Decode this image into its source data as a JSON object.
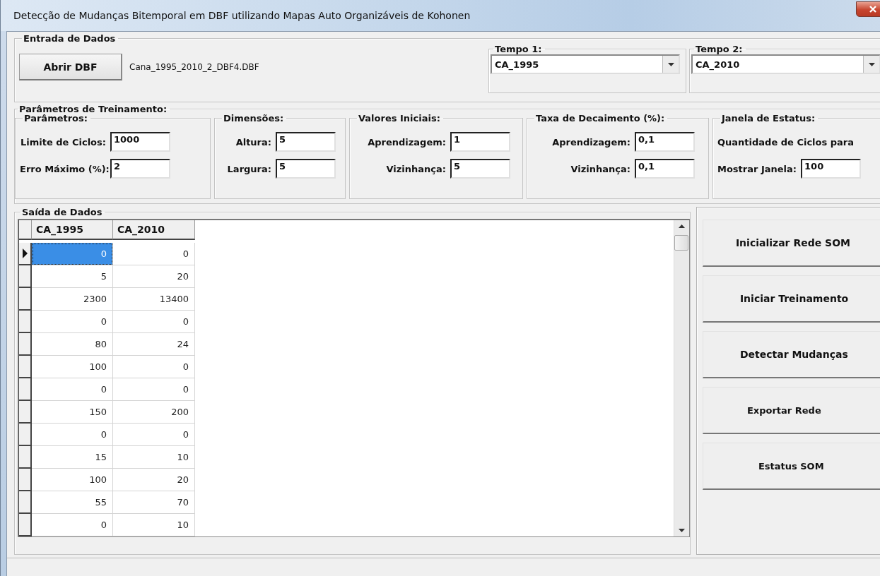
{
  "window": {
    "title": "Detecção de Mudanças Bitemporal em DBF utilizando Mapas Auto Organizáveis de Kohonen"
  },
  "input_section": {
    "title": "Entrada de Dados",
    "open_button": "Abrir DBF",
    "file_name": "Cana_1995_2010_2_DBF4.DBF",
    "time_selects": [
      {
        "label": "Tempo 1:",
        "value": "CA_1995"
      },
      {
        "label": "Tempo 2:",
        "value": "CA_2010"
      }
    ]
  },
  "training": {
    "title": "Parâmetros de Treinamento:",
    "groups": [
      {
        "title": "Parâmetros:",
        "items": [
          {
            "kind": "field",
            "label": "Limite de Ciclos:",
            "value": "1000"
          },
          {
            "kind": "field",
            "label": "Erro Máximo (%):",
            "value": "2"
          }
        ]
      },
      {
        "title": "Dimensões:",
        "items": [
          {
            "kind": "field",
            "label": "Altura:",
            "value": "5"
          },
          {
            "kind": "field",
            "label": "Largura:",
            "value": "5"
          }
        ]
      },
      {
        "title": "Valores Iniciais:",
        "items": [
          {
            "kind": "field",
            "label": "Aprendizagem:",
            "value": "1"
          },
          {
            "kind": "field",
            "label": "Vizinhança:",
            "value": "5"
          }
        ]
      },
      {
        "title": "Taxa de Decaimento (%):",
        "items": [
          {
            "kind": "field",
            "label": "Aprendizagem:",
            "value": "0,1"
          },
          {
            "kind": "field",
            "label": "Vizinhança:",
            "value": "0,1"
          }
        ]
      },
      {
        "title": "Janela de Estatus:",
        "items": [
          {
            "kind": "note",
            "label": "Quantidade de Ciclos para"
          },
          {
            "kind": "field",
            "label": "Mostrar Janela:",
            "value": "100"
          }
        ]
      }
    ]
  },
  "output": {
    "title": "Saída de Dados",
    "table": {
      "columns": [
        "CA_1995",
        "CA_2010"
      ],
      "rows": [
        {
          "cells": [
            "0",
            "0"
          ],
          "selected": true
        },
        {
          "cells": [
            "5",
            "20"
          ],
          "selected": false
        },
        {
          "cells": [
            "2300",
            "13400"
          ],
          "selected": false
        },
        {
          "cells": [
            "0",
            "0"
          ],
          "selected": false
        },
        {
          "cells": [
            "80",
            "24"
          ],
          "selected": false
        },
        {
          "cells": [
            "100",
            "0"
          ],
          "selected": false
        },
        {
          "cells": [
            "0",
            "0"
          ],
          "selected": false
        },
        {
          "cells": [
            "150",
            "200"
          ],
          "selected": false
        },
        {
          "cells": [
            "0",
            "0"
          ],
          "selected": false
        },
        {
          "cells": [
            "15",
            "10"
          ],
          "selected": false
        },
        {
          "cells": [
            "100",
            "20"
          ],
          "selected": false
        },
        {
          "cells": [
            "55",
            "70"
          ],
          "selected": false
        },
        {
          "cells": [
            "0",
            "10"
          ],
          "selected": false
        }
      ]
    }
  },
  "actions": [
    "Inicializar Rede SOM",
    "Iniciar Treinamento",
    "Detectar Mudanças",
    "Exportar Rede",
    "Estatus SOM"
  ]
}
